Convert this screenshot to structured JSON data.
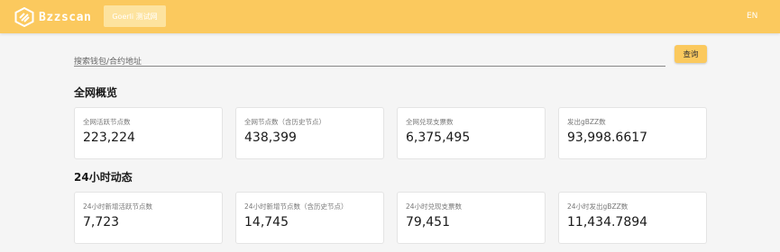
{
  "header": {
    "brand": "Bzzscan",
    "network_label": "Goerli 测试网",
    "language": "EN"
  },
  "search": {
    "placeholder": "搜索钱包/合约地址",
    "value": "",
    "button_label": "查询"
  },
  "overview": {
    "title": "全网概览",
    "cards": [
      {
        "label": "全网活跃节点数",
        "value": "223,224"
      },
      {
        "label": "全网节点数（含历史节点）",
        "value": "438,399"
      },
      {
        "label": "全网兑现支票数",
        "value": "6,375,495"
      },
      {
        "label": "发出gBZZ数",
        "value": "93,998.6617"
      }
    ]
  },
  "daily": {
    "title": "24小时动态",
    "cards": [
      {
        "label": "24小时新增活跃节点数",
        "value": "7,723"
      },
      {
        "label": "24小时新增节点数（含历史节点）",
        "value": "14,745"
      },
      {
        "label": "24小时兑现支票数",
        "value": "79,451"
      },
      {
        "label": "24小时发出gBZZ数",
        "value": "11,434.7894"
      }
    ]
  },
  "colors": {
    "header_bg": "#fbc95e",
    "network_button_bg": "#fde39f",
    "query_button_bg": "#fbc95e",
    "page_bg": "#f5f5f5"
  }
}
